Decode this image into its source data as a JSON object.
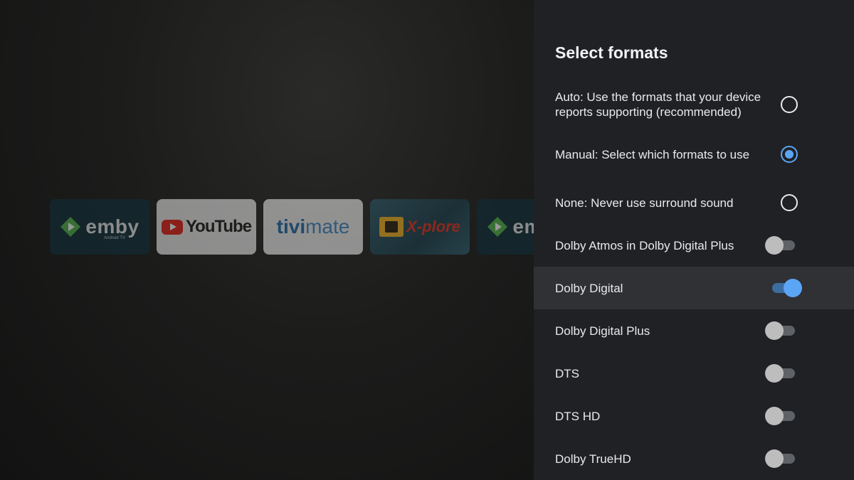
{
  "panel": {
    "title": "Select formats",
    "options": [
      {
        "label": "Auto: Use the formats that your device reports supporting (recommended)",
        "type": "radio",
        "checked": false
      },
      {
        "label": "Manual: Select which formats to use",
        "type": "radio",
        "checked": true
      },
      {
        "label": "None: Never use surround sound",
        "type": "radio",
        "checked": false
      },
      {
        "label": "Dolby Atmos in Dolby Digital Plus",
        "type": "toggle",
        "on": false
      },
      {
        "label": "Dolby Digital",
        "type": "toggle",
        "on": true
      },
      {
        "label": "Dolby Digital Plus",
        "type": "toggle",
        "on": false
      },
      {
        "label": "DTS",
        "type": "toggle",
        "on": false
      },
      {
        "label": "DTS HD",
        "type": "toggle",
        "on": false
      },
      {
        "label": "Dolby TrueHD",
        "type": "toggle",
        "on": false
      }
    ]
  },
  "apps": {
    "emby": {
      "name": "emby",
      "sub": "Android TV"
    },
    "youtube": {
      "name": "YouTube"
    },
    "tivimate": {
      "part1": "tivi",
      "part2": "mate"
    },
    "xplore": {
      "name": "X-plore"
    },
    "emby2": {
      "name": "emby"
    }
  },
  "colors": {
    "accent": "#5aa6f5",
    "panel_bg": "#202124",
    "focused_row": "#303134"
  }
}
